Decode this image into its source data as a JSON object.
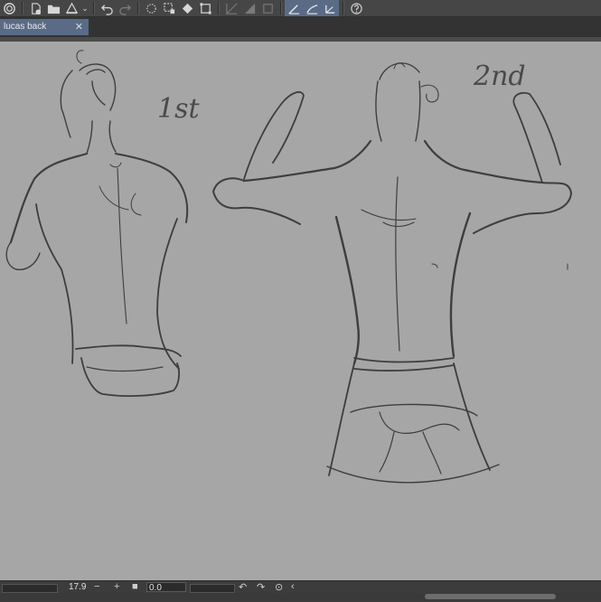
{
  "toolbar": {
    "items": [
      {
        "name": "app-logo-icon"
      },
      {
        "name": "new-file-icon"
      },
      {
        "name": "open-folder-icon"
      },
      {
        "name": "save-icon"
      },
      {
        "name": "undo-icon"
      },
      {
        "name": "redo-icon"
      },
      {
        "name": "clear-selection-icon"
      },
      {
        "name": "select-transform-icon"
      },
      {
        "name": "fill-icon"
      },
      {
        "name": "crop-icon"
      },
      {
        "name": "snap-to-ruler-icon"
      },
      {
        "name": "snap-to-grid-icon"
      },
      {
        "name": "snap-to-special-ruler-icon"
      },
      {
        "name": "pen-stabilization-icon"
      },
      {
        "name": "pen-curve-icon"
      },
      {
        "name": "pen-angle-icon"
      },
      {
        "name": "help-icon"
      }
    ]
  },
  "tab": {
    "title": "lucas back",
    "close_glyph": "✕"
  },
  "canvas": {
    "annotations": {
      "first": "1st",
      "second": "2nd"
    }
  },
  "status": {
    "zoom": "17.9",
    "zoom_minus": "−",
    "zoom_plus": "+",
    "angle": "0.0"
  },
  "colors": {
    "toolbar_bg": "#464646",
    "tab_active": "#5a6b87",
    "canvas_bg": "#a6a6a6",
    "sketch_stroke": "#3a3a3a"
  }
}
